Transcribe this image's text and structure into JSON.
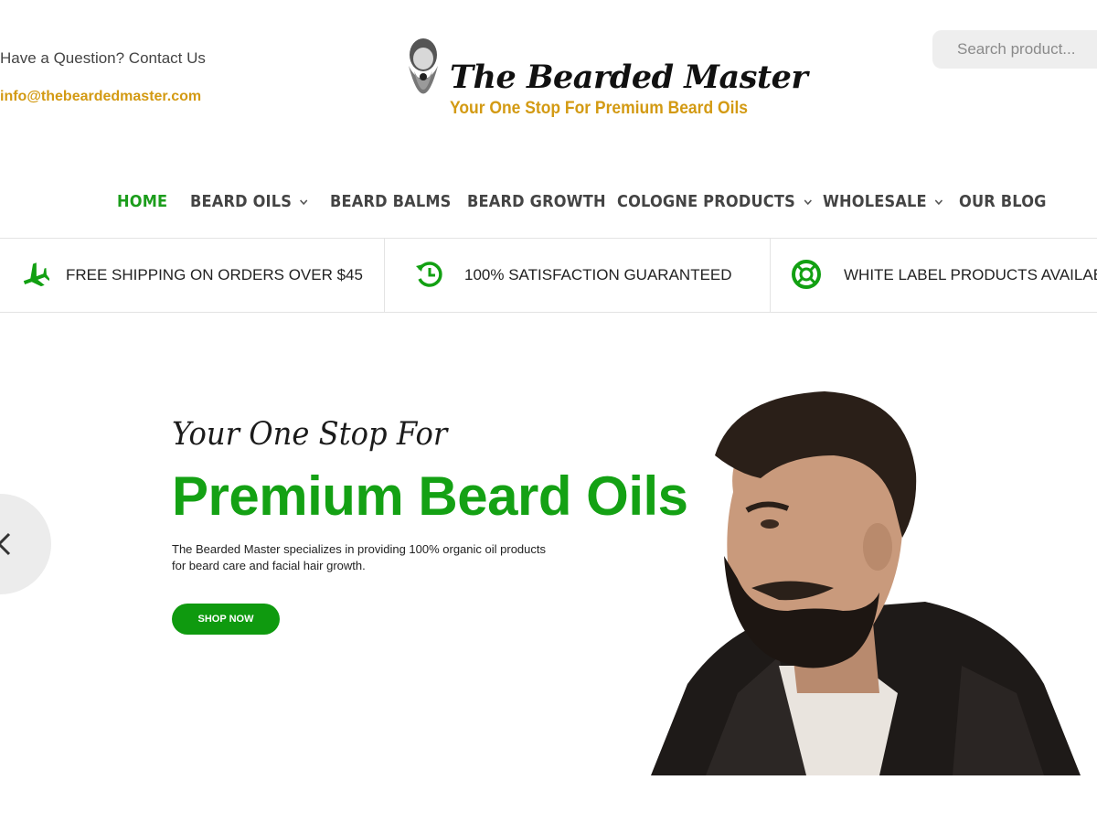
{
  "topbar": {
    "contact_question": "Have a Question? Contact Us",
    "email": "info@thebeardedmaster.com"
  },
  "logo": {
    "title": "The Bearded Master",
    "tagline": "Your One Stop For Premium Beard Oils"
  },
  "search": {
    "placeholder": "Search product..."
  },
  "nav": {
    "items": [
      {
        "label": "HOME",
        "active": true
      },
      {
        "label": "BEARD OILS",
        "dropdown": true
      },
      {
        "label": "BEARD BALMS"
      },
      {
        "label": "BEARD GROWTH"
      },
      {
        "label": "COLOGNE PRODUCTS",
        "dropdown": true
      },
      {
        "label": "WHOLESALE",
        "dropdown": true
      },
      {
        "label": "OUR BLOG"
      }
    ]
  },
  "features": [
    {
      "icon": "airplane-icon",
      "text": "FREE SHIPPING ON ORDERS OVER $45"
    },
    {
      "icon": "clock-icon",
      "text": "100% SATISFACTION GUARANTEED"
    },
    {
      "icon": "lifebuoy-icon",
      "text": "WHITE LABEL PRODUCTS AVAILABLE"
    }
  ],
  "hero": {
    "pretitle": "Your One Stop For",
    "title": "Premium Beard Oils",
    "description": "The Bearded Master specializes in providing 100% organic oil products for beard care and facial hair growth.",
    "button": "SHOP NOW"
  },
  "colors": {
    "accent_green": "#14a114",
    "gold": "#d39a13",
    "text": "#444444"
  }
}
